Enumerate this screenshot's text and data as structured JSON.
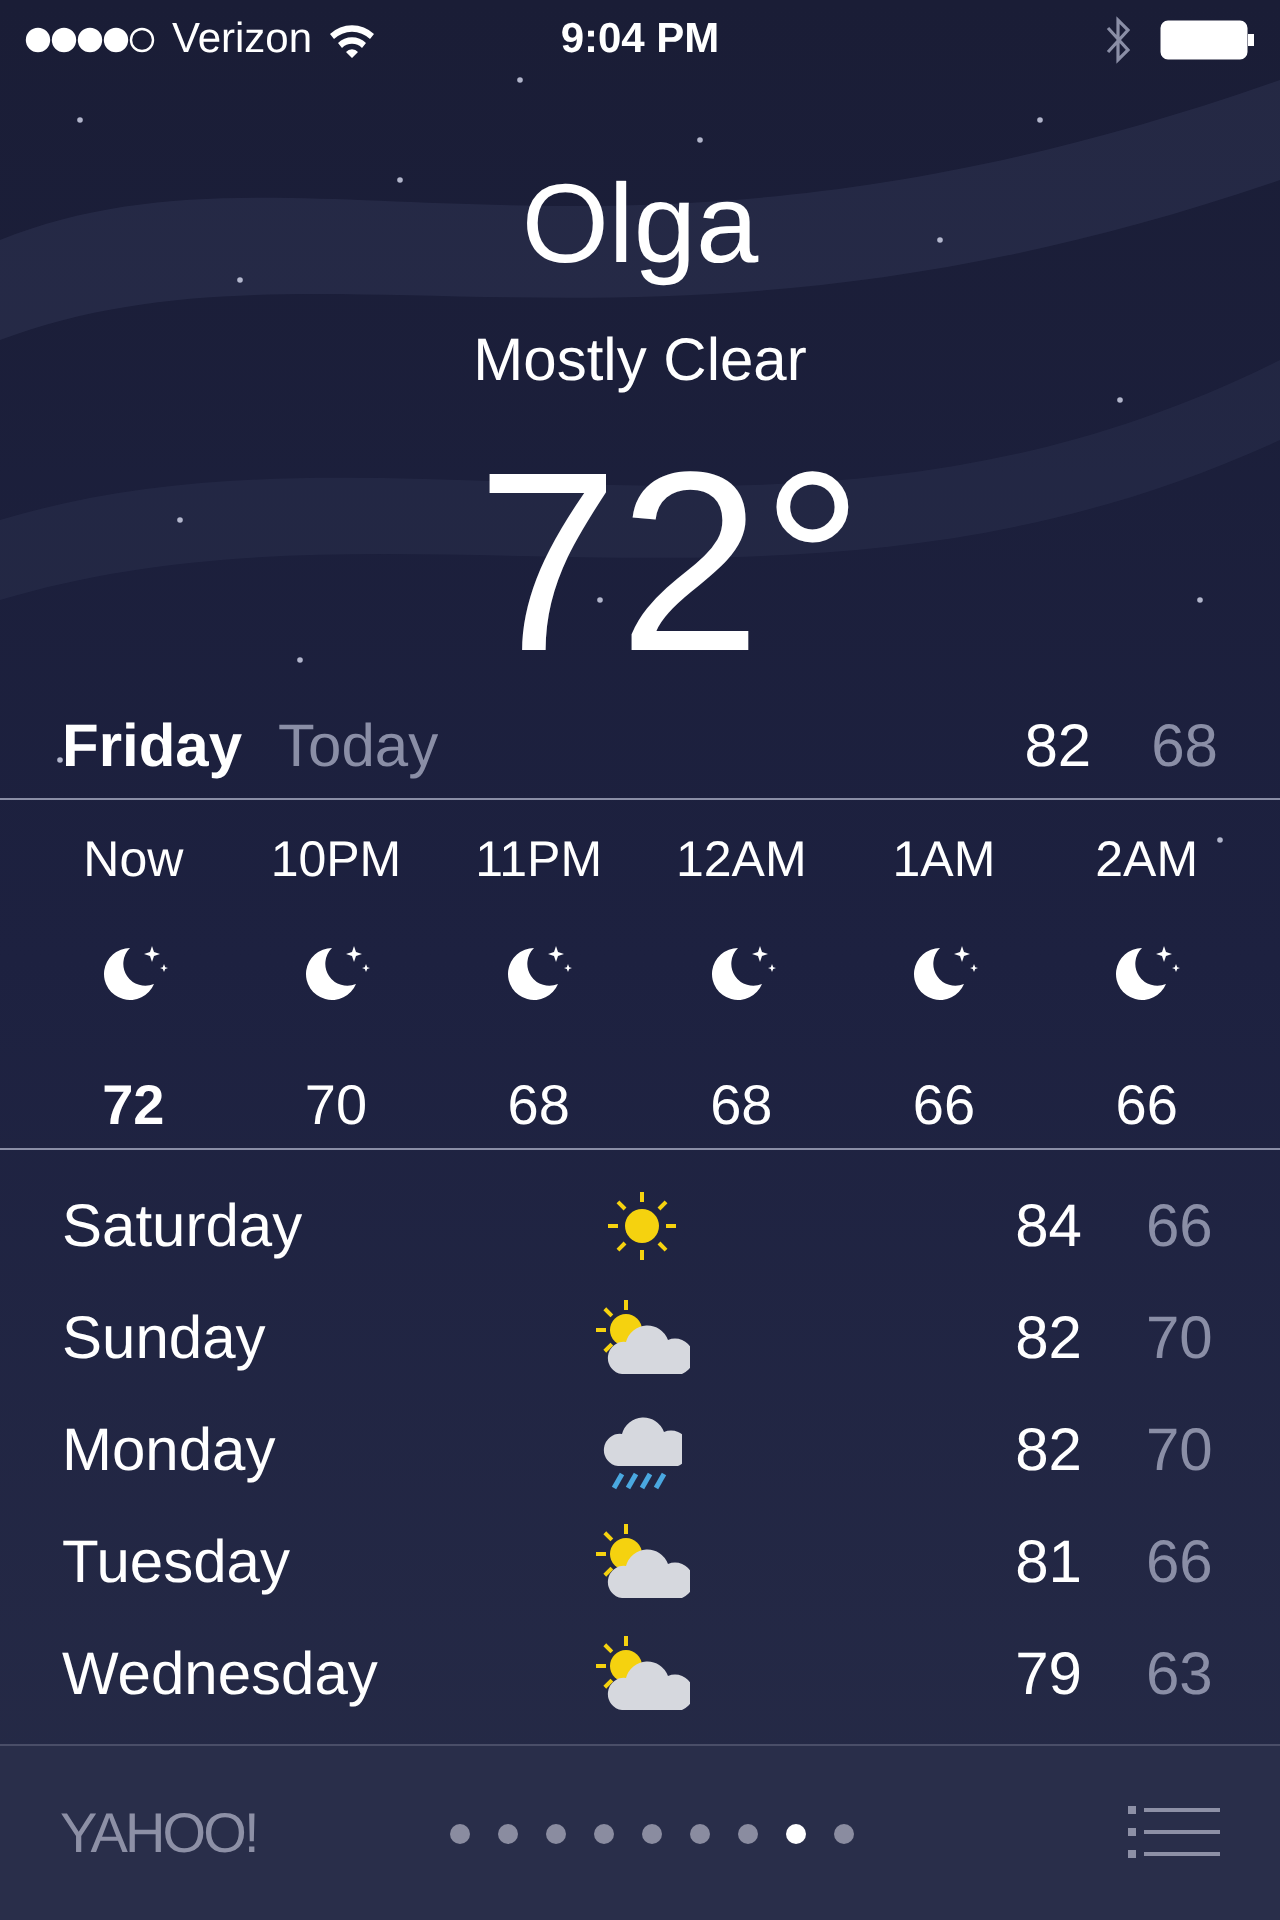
{
  "status_bar": {
    "carrier": "Verizon",
    "time": "9:04 PM"
  },
  "location": {
    "city": "Olga",
    "condition": "Mostly Clear",
    "temperature": "72°"
  },
  "today": {
    "day": "Friday",
    "label": "Today",
    "high": "82",
    "low": "68"
  },
  "hourly": [
    {
      "time": "Now",
      "kind": "moon",
      "temp": "72",
      "current": true
    },
    {
      "time": "10PM",
      "kind": "moon",
      "temp": "70",
      "current": false
    },
    {
      "time": "11PM",
      "kind": "moon",
      "temp": "68",
      "current": false
    },
    {
      "time": "12AM",
      "kind": "moon",
      "temp": "68",
      "current": false
    },
    {
      "time": "1AM",
      "kind": "moon",
      "temp": "66",
      "current": false
    },
    {
      "time": "2AM",
      "kind": "moon",
      "temp": "66",
      "current": false
    }
  ],
  "daily": [
    {
      "day": "Saturday",
      "kind": "sun",
      "high": "84",
      "low": "66"
    },
    {
      "day": "Sunday",
      "kind": "partly",
      "high": "82",
      "low": "70"
    },
    {
      "day": "Monday",
      "kind": "rain",
      "high": "82",
      "low": "70"
    },
    {
      "day": "Tuesday",
      "kind": "partly",
      "high": "81",
      "low": "66"
    },
    {
      "day": "Wednesday",
      "kind": "partly",
      "high": "79",
      "low": "63"
    }
  ],
  "footer": {
    "logo": "YAHOO!",
    "pages": [
      {
        "selected": false
      },
      {
        "selected": false
      },
      {
        "selected": false
      },
      {
        "selected": false
      },
      {
        "selected": false
      },
      {
        "selected": false
      },
      {
        "selected": false
      },
      {
        "selected": true
      },
      {
        "selected": false
      }
    ]
  }
}
